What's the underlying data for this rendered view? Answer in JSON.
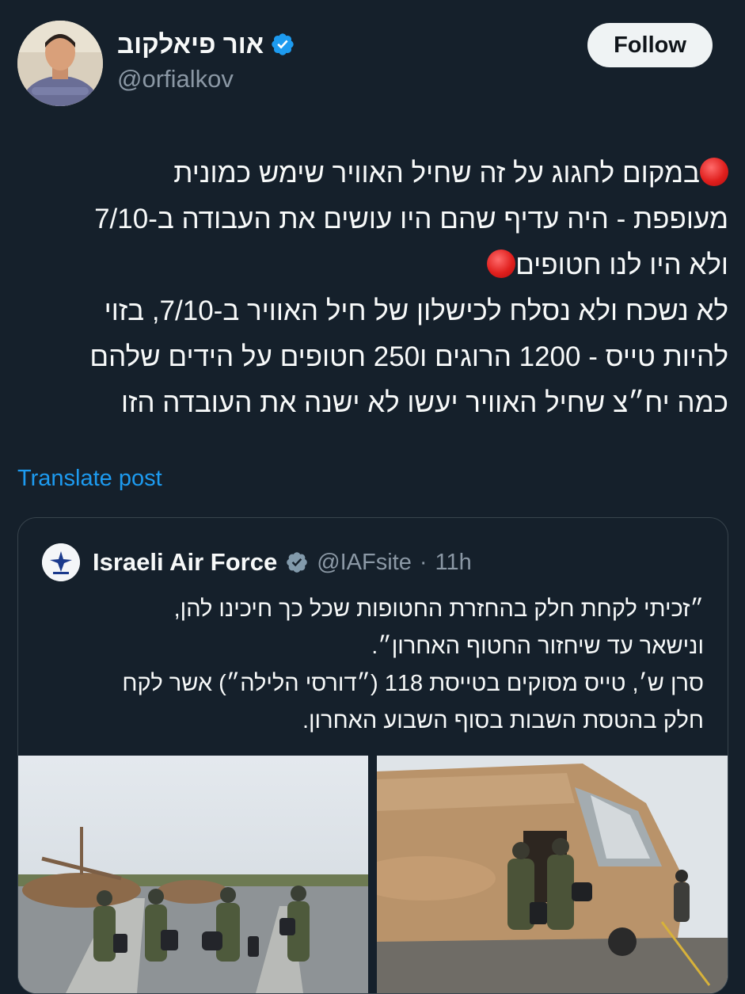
{
  "author": {
    "display_name": "אור פיאלקוב",
    "handle": "@orfialkov",
    "verified_icon": "verified-badge-icon"
  },
  "follow_button": {
    "label": "Follow"
  },
  "post": {
    "lines": [
      "במקום לחגוג על זה שחיל האוויר שימש כמונית",
      "מעופפת - היה עדיף שהם היו עושים את העבודה ב-7/10",
      "ולא היו לנו חטופים",
      "לא נשכח ולא נסלח לכישלון של חיל האוויר ב-7/10, בזוי",
      "להיות טייס - 1200 הרוגים ו250 חטופים על הידים שלהם",
      "כמה יח״צ שחיל האוויר יעשו לא ישנה את העובדה הזו"
    ]
  },
  "translate": {
    "label": "Translate post"
  },
  "quoted": {
    "name": "Israeli Air Force",
    "handle": "@IAFsite",
    "separator": "·",
    "time": "11h",
    "lines": [
      "״זכיתי לקחת חלק בהחזרת החטופות שכל כך חיכינו להן,",
      "ונישאר עד שיחזור החטוף האחרון״.",
      "סרן ש׳, טייס מסוקים בטייסת 118 (״דורסי הלילה״) אשר לקח",
      "חלק בהטסת השבות בסוף השבוע האחרון."
    ]
  },
  "colors": {
    "background": "#15202b",
    "text": "#f7f9f9",
    "secondary": "#8b98a5",
    "link": "#1d9bf0",
    "verified": "#1d9bf0"
  }
}
